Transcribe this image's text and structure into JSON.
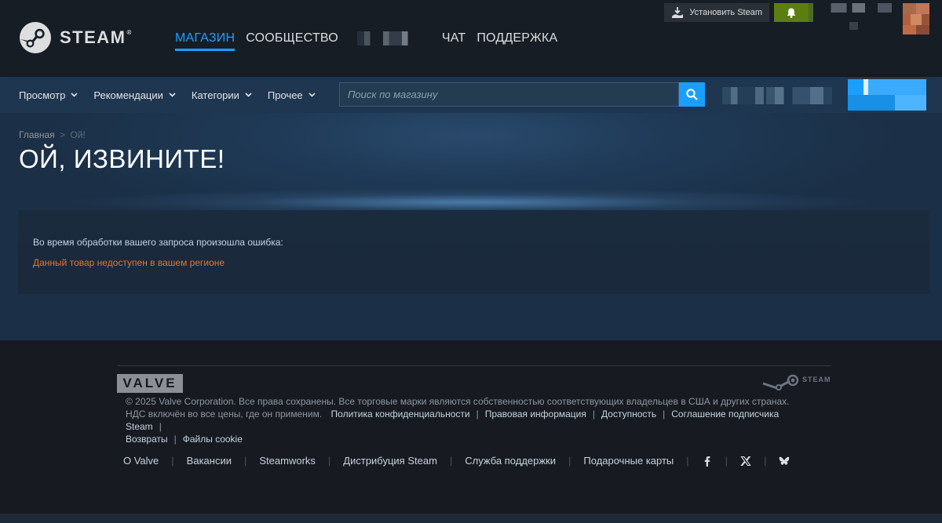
{
  "header": {
    "logo_text": "STEAM",
    "logo_reg": "®",
    "nav": [
      {
        "label": "МАГАЗИН"
      },
      {
        "label": "СООБЩЕСТВО"
      },
      {
        "label": "ЧАТ"
      },
      {
        "label": "ПОДДЕРЖКА"
      }
    ],
    "install_label": "Установить Steam"
  },
  "store_nav": {
    "tabs": [
      {
        "label": "Просмотр"
      },
      {
        "label": "Рекомендации"
      },
      {
        "label": "Категории"
      },
      {
        "label": "Прочее"
      }
    ],
    "search_placeholder": "Поиск по магазину"
  },
  "breadcrumb": {
    "home": "Главная",
    "separator": ">",
    "current": "Ой!"
  },
  "page_title": "ОЙ, ИЗВИНИТЕ!",
  "error": {
    "intro": "Во время обработки вашего запроса произошла ошибка:",
    "message": "Данный товар недоступен в вашем регионе"
  },
  "footer": {
    "valve_logo": "VALVE",
    "steam_logo": "STEAM",
    "copyright": "© 2025 Valve Corporation. Все права сохранены. Все торговые марки являются собственностью соответствующих владельцев в США и других странах.",
    "vat_note": "НДС включён во все цены, где он применим.",
    "legal_links": [
      {
        "label": "Политика конфиденциальности"
      },
      {
        "label": "Правовая информация"
      },
      {
        "label": "Доступность"
      },
      {
        "label": "Соглашение подписчика Steam"
      },
      {
        "label": "Возвраты"
      },
      {
        "label": "Файлы cookie"
      }
    ],
    "links": [
      {
        "label": "О Valve"
      },
      {
        "label": "Вакансии"
      },
      {
        "label": "Steamworks"
      },
      {
        "label": "Дистрибуция Steam"
      },
      {
        "label": "Служба поддержки"
      },
      {
        "label": "Подарочные карты"
      }
    ],
    "social": [
      "facebook-icon",
      "x-icon",
      "bluesky-icon"
    ]
  },
  "colors": {
    "accent": "#1a9fff",
    "error": "#e8732d",
    "notification": "#5c7e10"
  }
}
